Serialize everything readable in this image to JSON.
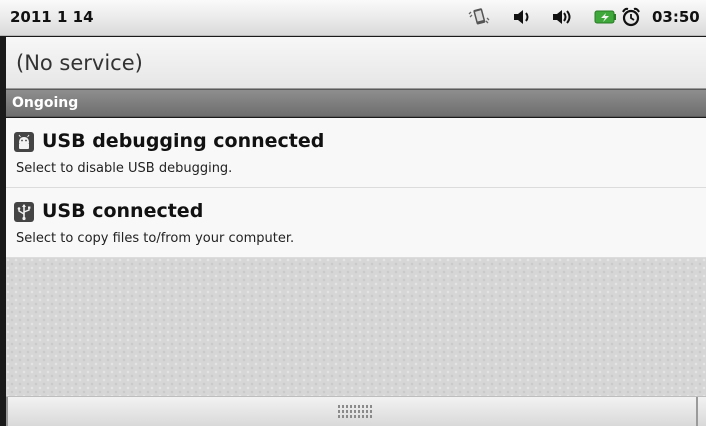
{
  "status_bar": {
    "date": "2011 1 14",
    "time": "03:50",
    "icons": [
      "vibrate-icon",
      "volume-icon",
      "volume-loud-icon",
      "battery-charging-icon",
      "alarm-clock-icon"
    ],
    "battery_color": "#3fa83a"
  },
  "carrier": {
    "label": "(No service)"
  },
  "sections": {
    "ongoing_label": "Ongoing"
  },
  "notifications": [
    {
      "icon": "android-debug-icon",
      "title": "USB debugging connected",
      "text": "Select to disable USB debugging."
    },
    {
      "icon": "usb-icon",
      "title": "USB connected",
      "text": "Select to copy files to/from your computer."
    }
  ]
}
